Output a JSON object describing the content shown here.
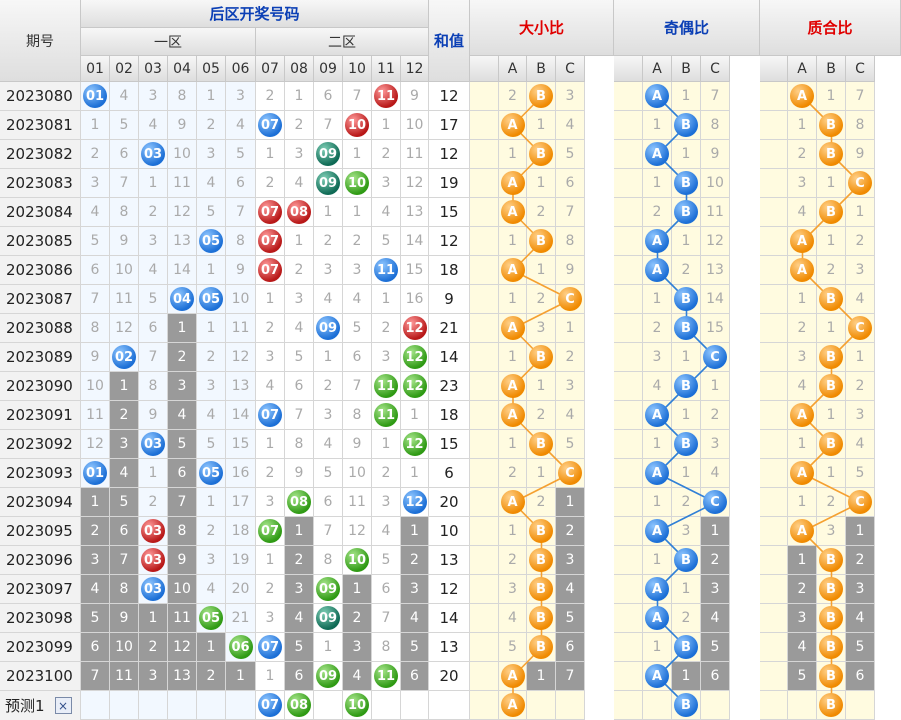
{
  "header": {
    "period_label": "期号",
    "back_zone_title": "后区开奖号码",
    "zone1_label": "一区",
    "zone2_label": "二区",
    "sum_label": "和值",
    "size_ratio_label": "大小比",
    "odd_even_label": "奇偶比",
    "prime_label": "质合比",
    "numbers": [
      "01",
      "02",
      "03",
      "04",
      "05",
      "06",
      "07",
      "08",
      "09",
      "10",
      "11",
      "12"
    ],
    "abc": [
      "A",
      "B",
      "C"
    ]
  },
  "colors": {
    "blue": "#1c6fd6",
    "red": "#b81818",
    "green": "#2f9a14",
    "teal": "#0f6a55",
    "orange": "#f08a00",
    "line_orange": "#f5a030",
    "line_blue": "#2f7fd6"
  },
  "rows": [
    {
      "period": "2023080",
      "nums": [
        {
          "v": "01",
          "c": "blue"
        },
        "4",
        "3",
        "8",
        "1",
        "3",
        "2",
        "1",
        "6",
        "7",
        {
          "v": "11",
          "c": "red"
        },
        "9"
      ],
      "sum": "12",
      "size": [
        "2",
        {
          "v": "B"
        },
        "3"
      ],
      "oe": [
        {
          "v": "A"
        },
        "1",
        "7"
      ],
      "pc": [
        {
          "v": "A"
        },
        "1",
        "7"
      ]
    },
    {
      "period": "2023081",
      "nums": [
        "1",
        "5",
        "4",
        "9",
        "2",
        "4",
        {
          "v": "07",
          "c": "blue"
        },
        "2",
        "7",
        {
          "v": "10",
          "c": "red"
        },
        "1",
        "10"
      ],
      "sum": "17",
      "size": [
        {
          "v": "A"
        },
        "1",
        "4"
      ],
      "oe": [
        "1",
        {
          "v": "B"
        },
        "8"
      ],
      "pc": [
        "1",
        {
          "v": "B"
        },
        "8"
      ]
    },
    {
      "period": "2023082",
      "nums": [
        "2",
        "6",
        {
          "v": "03",
          "c": "blue"
        },
        "10",
        "3",
        "5",
        "1",
        "3",
        {
          "v": "09",
          "c": "teal"
        },
        "1",
        "2",
        "11"
      ],
      "sum": "12",
      "size": [
        "1",
        {
          "v": "B"
        },
        "5"
      ],
      "oe": [
        {
          "v": "A"
        },
        "1",
        "9"
      ],
      "pc": [
        "2",
        {
          "v": "B"
        },
        "9"
      ]
    },
    {
      "period": "2023083",
      "nums": [
        "3",
        "7",
        "1",
        "11",
        "4",
        "6",
        "2",
        "4",
        {
          "v": "09",
          "c": "teal"
        },
        {
          "v": "10",
          "c": "green"
        },
        "3",
        "12"
      ],
      "sum": "19",
      "size": [
        {
          "v": "A"
        },
        "1",
        "6"
      ],
      "oe": [
        "1",
        {
          "v": "B"
        },
        "10"
      ],
      "pc": [
        "3",
        "1",
        {
          "v": "C"
        }
      ]
    },
    {
      "period": "2023084",
      "nums": [
        "4",
        "8",
        "2",
        "12",
        "5",
        "7",
        {
          "v": "07",
          "c": "red"
        },
        {
          "v": "08",
          "c": "red"
        },
        "1",
        "1",
        "4",
        "13"
      ],
      "sum": "15",
      "size": [
        {
          "v": "A"
        },
        "2",
        "7"
      ],
      "oe": [
        "2",
        {
          "v": "B"
        },
        "11"
      ],
      "pc": [
        "4",
        {
          "v": "B"
        },
        "1"
      ]
    },
    {
      "period": "2023085",
      "nums": [
        "5",
        "9",
        "3",
        "13",
        {
          "v": "05",
          "c": "blue"
        },
        "8",
        {
          "v": "07",
          "c": "red"
        },
        "1",
        "2",
        "2",
        "5",
        "14"
      ],
      "sum": "12",
      "size": [
        "1",
        {
          "v": "B"
        },
        "8"
      ],
      "oe": [
        {
          "v": "A"
        },
        "1",
        "12"
      ],
      "pc": [
        {
          "v": "A"
        },
        "1",
        "2"
      ]
    },
    {
      "period": "2023086",
      "nums": [
        "6",
        "10",
        "4",
        "14",
        "1",
        "9",
        {
          "v": "07",
          "c": "red"
        },
        "2",
        "3",
        "3",
        {
          "v": "11",
          "c": "blue"
        },
        "15"
      ],
      "sum": "18",
      "size": [
        {
          "v": "A"
        },
        "1",
        "9"
      ],
      "oe": [
        {
          "v": "A"
        },
        "2",
        "13"
      ],
      "pc": [
        {
          "v": "A"
        },
        "2",
        "3"
      ]
    },
    {
      "period": "2023087",
      "nums": [
        "7",
        "11",
        "5",
        {
          "v": "04",
          "c": "blue"
        },
        {
          "v": "05",
          "c": "blue"
        },
        "10",
        "1",
        "3",
        "4",
        "4",
        "1",
        "16"
      ],
      "sum": "9",
      "size": [
        "1",
        "2",
        {
          "v": "C"
        }
      ],
      "oe": [
        "1",
        {
          "v": "B"
        },
        "14"
      ],
      "pc": [
        "1",
        {
          "v": "B"
        },
        "4"
      ]
    },
    {
      "period": "2023088",
      "nums": [
        "8",
        "12",
        "6",
        {
          "v": "1",
          "g": 1
        },
        "1",
        "11",
        "2",
        "4",
        {
          "v": "09",
          "c": "blue"
        },
        "5",
        "2",
        {
          "v": "12",
          "c": "red"
        }
      ],
      "sum": "21",
      "size": [
        {
          "v": "A"
        },
        "3",
        "1"
      ],
      "oe": [
        "2",
        {
          "v": "B"
        },
        "15"
      ],
      "pc": [
        "2",
        "1",
        {
          "v": "C"
        }
      ]
    },
    {
      "period": "2023089",
      "nums": [
        "9",
        {
          "v": "02",
          "c": "blue"
        },
        "7",
        {
          "v": "2",
          "g": 1
        },
        "2",
        "12",
        "3",
        "5",
        "1",
        "6",
        "3",
        {
          "v": "12",
          "c": "green"
        }
      ],
      "sum": "14",
      "size": [
        "1",
        {
          "v": "B"
        },
        "2"
      ],
      "oe": [
        "3",
        "1",
        {
          "v": "C"
        }
      ],
      "pc": [
        "3",
        {
          "v": "B"
        },
        "1"
      ]
    },
    {
      "period": "2023090",
      "nums": [
        "10",
        {
          "v": "1",
          "g": 1
        },
        "8",
        {
          "v": "3",
          "g": 1
        },
        "3",
        "13",
        "4",
        "6",
        "2",
        "7",
        {
          "v": "11",
          "c": "green"
        },
        {
          "v": "12",
          "c": "green"
        }
      ],
      "sum": "23",
      "size": [
        {
          "v": "A"
        },
        "1",
        "3"
      ],
      "oe": [
        "4",
        {
          "v": "B"
        },
        "1"
      ],
      "pc": [
        "4",
        {
          "v": "B"
        },
        "2"
      ]
    },
    {
      "period": "2023091",
      "nums": [
        "11",
        {
          "v": "2",
          "g": 1
        },
        "9",
        {
          "v": "4",
          "g": 1
        },
        "4",
        "14",
        {
          "v": "07",
          "c": "blue"
        },
        "7",
        "3",
        "8",
        {
          "v": "11",
          "c": "green"
        },
        "1"
      ],
      "sum": "18",
      "size": [
        {
          "v": "A"
        },
        "2",
        "4"
      ],
      "oe": [
        {
          "v": "A"
        },
        "1",
        "2"
      ],
      "pc": [
        {
          "v": "A"
        },
        "1",
        "3"
      ]
    },
    {
      "period": "2023092",
      "nums": [
        "12",
        {
          "v": "3",
          "g": 1
        },
        {
          "v": "03",
          "c": "blue"
        },
        {
          "v": "5",
          "g": 1
        },
        "5",
        "15",
        "1",
        "8",
        "4",
        "9",
        "1",
        {
          "v": "12",
          "c": "green"
        }
      ],
      "sum": "15",
      "size": [
        "1",
        {
          "v": "B"
        },
        "5"
      ],
      "oe": [
        "1",
        {
          "v": "B"
        },
        "3"
      ],
      "pc": [
        "1",
        {
          "v": "B"
        },
        "4"
      ]
    },
    {
      "period": "2023093",
      "nums": [
        {
          "v": "01",
          "c": "blue"
        },
        {
          "v": "4",
          "g": 1
        },
        "1",
        {
          "v": "6",
          "g": 1
        },
        {
          "v": "05",
          "c": "blue"
        },
        "16",
        "2",
        "9",
        "5",
        "10",
        "2",
        "1"
      ],
      "sum": "6",
      "size": [
        "2",
        "1",
        {
          "v": "C"
        }
      ],
      "oe": [
        {
          "v": "A"
        },
        "1",
        "4"
      ],
      "pc": [
        {
          "v": "A"
        },
        "1",
        "5"
      ]
    },
    {
      "period": "2023094",
      "nums": [
        {
          "v": "1",
          "g": 1
        },
        {
          "v": "5",
          "g": 1
        },
        "2",
        {
          "v": "7",
          "g": 1
        },
        "1",
        "17",
        "3",
        {
          "v": "08",
          "c": "green"
        },
        "6",
        "11",
        "3",
        {
          "v": "12",
          "c": "blue"
        }
      ],
      "sum": "20",
      "size": [
        {
          "v": "A"
        },
        "2",
        {
          "v": "1",
          "g": 1
        }
      ],
      "oe": [
        "1",
        "2",
        {
          "v": "C"
        }
      ],
      "pc": [
        "1",
        "2",
        {
          "v": "C"
        }
      ]
    },
    {
      "period": "2023095",
      "nums": [
        {
          "v": "2",
          "g": 1
        },
        {
          "v": "6",
          "g": 1
        },
        {
          "v": "03",
          "c": "red"
        },
        {
          "v": "8",
          "g": 1
        },
        "2",
        "18",
        {
          "v": "07",
          "c": "green"
        },
        {
          "v": "1",
          "g": 1
        },
        "7",
        "12",
        "4",
        {
          "v": "1",
          "g": 1
        }
      ],
      "sum": "10",
      "size": [
        "1",
        {
          "v": "B"
        },
        {
          "v": "2",
          "g": 1
        }
      ],
      "oe": [
        {
          "v": "A"
        },
        "3",
        {
          "v": "1",
          "g": 1
        }
      ],
      "pc": [
        {
          "v": "A"
        },
        "3",
        {
          "v": "1",
          "g": 1
        }
      ]
    },
    {
      "period": "2023096",
      "nums": [
        {
          "v": "3",
          "g": 1
        },
        {
          "v": "7",
          "g": 1
        },
        {
          "v": "03",
          "c": "red"
        },
        {
          "v": "9",
          "g": 1
        },
        "3",
        "19",
        "1",
        {
          "v": "2",
          "g": 1
        },
        "8",
        {
          "v": "10",
          "c": "green"
        },
        "5",
        {
          "v": "2",
          "g": 1
        }
      ],
      "sum": "13",
      "size": [
        "2",
        {
          "v": "B"
        },
        {
          "v": "3",
          "g": 1
        }
      ],
      "oe": [
        "1",
        {
          "v": "B"
        },
        {
          "v": "2",
          "g": 1
        }
      ],
      "pc": [
        {
          "v": "1",
          "g": 1
        },
        {
          "v": "B"
        },
        {
          "v": "2",
          "g": 1
        }
      ]
    },
    {
      "period": "2023097",
      "nums": [
        {
          "v": "4",
          "g": 1
        },
        {
          "v": "8",
          "g": 1
        },
        {
          "v": "03",
          "c": "blue"
        },
        {
          "v": "10",
          "g": 1
        },
        "4",
        "20",
        "2",
        {
          "v": "3",
          "g": 1
        },
        {
          "v": "09",
          "c": "green"
        },
        {
          "v": "1",
          "g": 1
        },
        "6",
        {
          "v": "3",
          "g": 1
        }
      ],
      "sum": "12",
      "size": [
        "3",
        {
          "v": "B"
        },
        {
          "v": "4",
          "g": 1
        }
      ],
      "oe": [
        {
          "v": "A"
        },
        "1",
        {
          "v": "3",
          "g": 1
        }
      ],
      "pc": [
        {
          "v": "2",
          "g": 1
        },
        {
          "v": "B"
        },
        {
          "v": "3",
          "g": 1
        }
      ]
    },
    {
      "period": "2023098",
      "nums": [
        {
          "v": "5",
          "g": 1
        },
        {
          "v": "9",
          "g": 1
        },
        {
          "v": "1",
          "g": 1
        },
        {
          "v": "11",
          "g": 1
        },
        {
          "v": "05",
          "c": "green"
        },
        "21",
        "3",
        {
          "v": "4",
          "g": 1
        },
        {
          "v": "09",
          "c": "teal"
        },
        {
          "v": "2",
          "g": 1
        },
        "7",
        {
          "v": "4",
          "g": 1
        }
      ],
      "sum": "14",
      "size": [
        "4",
        {
          "v": "B"
        },
        {
          "v": "5",
          "g": 1
        }
      ],
      "oe": [
        {
          "v": "A"
        },
        "2",
        {
          "v": "4",
          "g": 1
        }
      ],
      "pc": [
        {
          "v": "3",
          "g": 1
        },
        {
          "v": "B"
        },
        {
          "v": "4",
          "g": 1
        }
      ]
    },
    {
      "period": "2023099",
      "nums": [
        {
          "v": "6",
          "g": 1
        },
        {
          "v": "10",
          "g": 1
        },
        {
          "v": "2",
          "g": 1
        },
        {
          "v": "12",
          "g": 1
        },
        {
          "v": "1",
          "g": 1
        },
        {
          "v": "06",
          "c": "green"
        },
        {
          "v": "07",
          "c": "blue"
        },
        {
          "v": "5",
          "g": 1
        },
        "1",
        {
          "v": "3",
          "g": 1
        },
        "8",
        {
          "v": "5",
          "g": 1
        }
      ],
      "sum": "13",
      "size": [
        "5",
        {
          "v": "B"
        },
        {
          "v": "6",
          "g": 1
        }
      ],
      "oe": [
        "1",
        {
          "v": "B"
        },
        {
          "v": "5",
          "g": 1
        }
      ],
      "pc": [
        {
          "v": "4",
          "g": 1
        },
        {
          "v": "B"
        },
        {
          "v": "5",
          "g": 1
        }
      ]
    },
    {
      "period": "2023100",
      "nums": [
        {
          "v": "7",
          "g": 1
        },
        {
          "v": "11",
          "g": 1
        },
        {
          "v": "3",
          "g": 1
        },
        {
          "v": "13",
          "g": 1
        },
        {
          "v": "2",
          "g": 1
        },
        {
          "v": "1",
          "g": 1
        },
        "1",
        {
          "v": "6",
          "g": 1
        },
        {
          "v": "09",
          "c": "green"
        },
        {
          "v": "4",
          "g": 1
        },
        {
          "v": "11",
          "c": "green"
        },
        {
          "v": "6",
          "g": 1
        }
      ],
      "sum": "20",
      "size": [
        {
          "v": "A"
        },
        {
          "v": "1",
          "g": 1
        },
        {
          "v": "7",
          "g": 1
        }
      ],
      "oe": [
        {
          "v": "A"
        },
        {
          "v": "1",
          "g": 1
        },
        {
          "v": "6",
          "g": 1
        }
      ],
      "pc": [
        {
          "v": "5",
          "g": 1
        },
        {
          "v": "B"
        },
        {
          "v": "6",
          "g": 1
        }
      ]
    }
  ],
  "prediction": {
    "label": "预测1",
    "close_symbol": "×",
    "nums": [
      "",
      "",
      "",
      "",
      "",
      "",
      {
        "v": "07",
        "c": "blue"
      },
      {
        "v": "08",
        "c": "green"
      },
      "",
      {
        "v": "10",
        "c": "green"
      },
      "",
      ""
    ],
    "size": [
      {
        "v": "A"
      },
      "",
      ""
    ],
    "oe": [
      "",
      {
        "v": "B"
      },
      ""
    ],
    "pc": [
      "",
      {
        "v": "B"
      },
      ""
    ]
  }
}
